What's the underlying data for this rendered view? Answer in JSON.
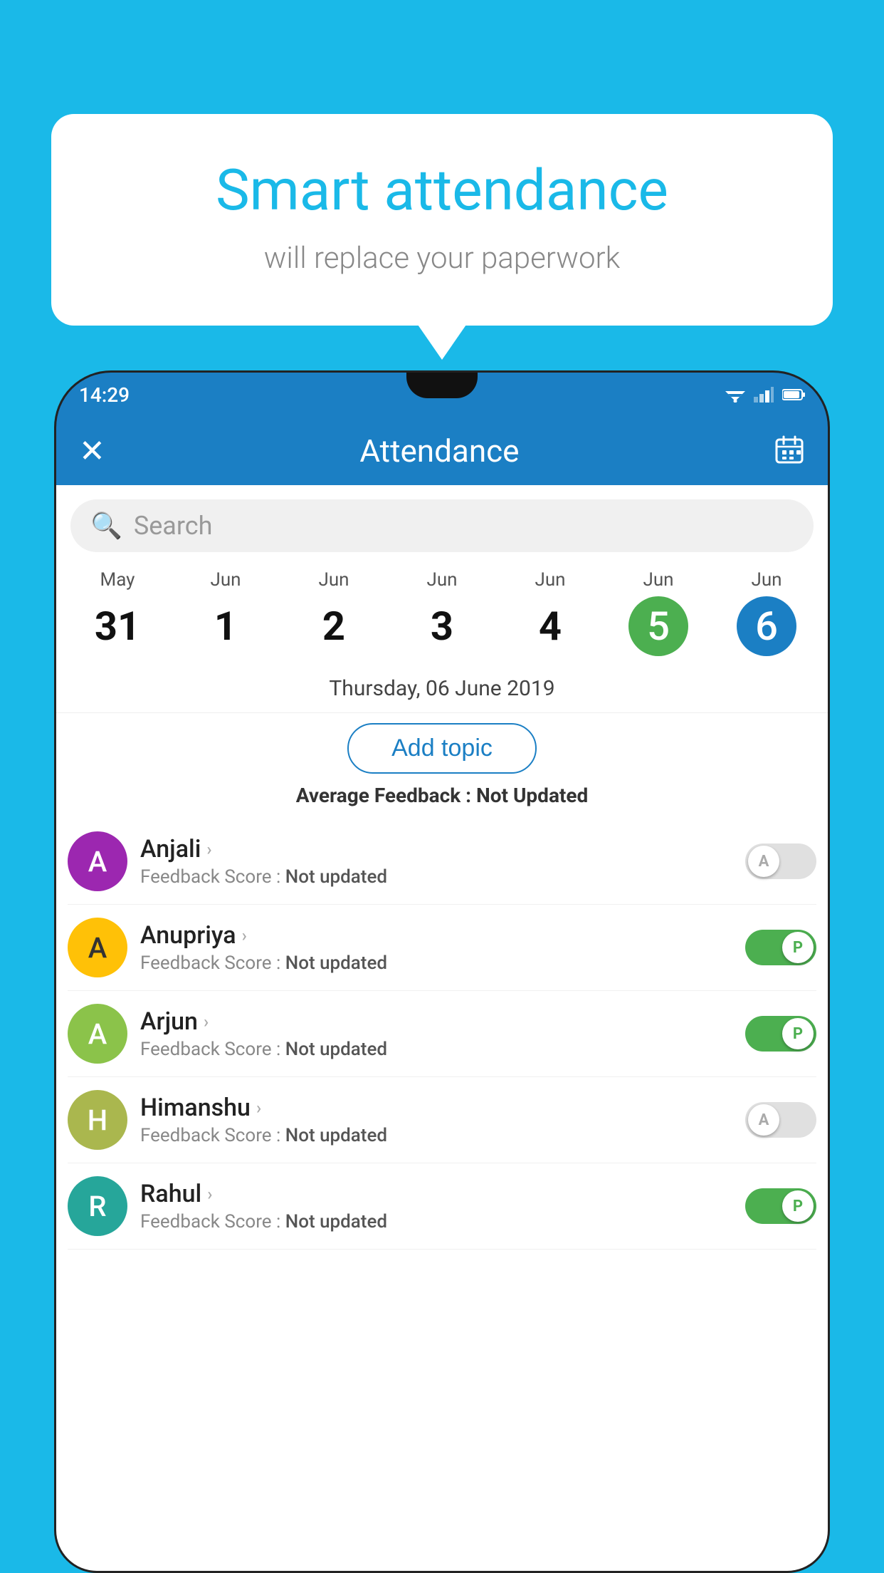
{
  "background_color": "#1ab9e8",
  "bubble": {
    "title": "Smart attendance",
    "subtitle": "will replace your paperwork"
  },
  "status_bar": {
    "time": "14:29"
  },
  "header": {
    "title": "Attendance",
    "close_label": "✕",
    "calendar_label": "📅"
  },
  "search": {
    "placeholder": "Search"
  },
  "dates": [
    {
      "month": "May",
      "day": "31",
      "style": "normal"
    },
    {
      "month": "Jun",
      "day": "1",
      "style": "normal"
    },
    {
      "month": "Jun",
      "day": "2",
      "style": "normal"
    },
    {
      "month": "Jun",
      "day": "3",
      "style": "normal"
    },
    {
      "month": "Jun",
      "day": "4",
      "style": "normal"
    },
    {
      "month": "Jun",
      "day": "5",
      "style": "green"
    },
    {
      "month": "Jun",
      "day": "6",
      "style": "blue"
    }
  ],
  "selected_date": "Thursday, 06 June 2019",
  "add_topic_label": "Add topic",
  "feedback_label": "Average Feedback :",
  "feedback_value": "Not Updated",
  "students": [
    {
      "name": "Anjali",
      "avatar_letter": "A",
      "avatar_color": "purple",
      "feedback_label": "Feedback Score :",
      "feedback_value": "Not updated",
      "toggle_state": "off",
      "toggle_letter": "A"
    },
    {
      "name": "Anupriya",
      "avatar_letter": "A",
      "avatar_color": "yellow",
      "feedback_label": "Feedback Score :",
      "feedback_value": "Not updated",
      "toggle_state": "on",
      "toggle_letter": "P"
    },
    {
      "name": "Arjun",
      "avatar_letter": "A",
      "avatar_color": "green",
      "feedback_label": "Feedback Score :",
      "feedback_value": "Not updated",
      "toggle_state": "on",
      "toggle_letter": "P"
    },
    {
      "name": "Himanshu",
      "avatar_letter": "H",
      "avatar_color": "olive",
      "feedback_label": "Feedback Score :",
      "feedback_value": "Not updated",
      "toggle_state": "off",
      "toggle_letter": "A"
    },
    {
      "name": "Rahul",
      "avatar_letter": "R",
      "avatar_color": "teal",
      "feedback_label": "Feedback Score :",
      "feedback_value": "Not updated",
      "toggle_state": "on",
      "toggle_letter": "P"
    }
  ]
}
